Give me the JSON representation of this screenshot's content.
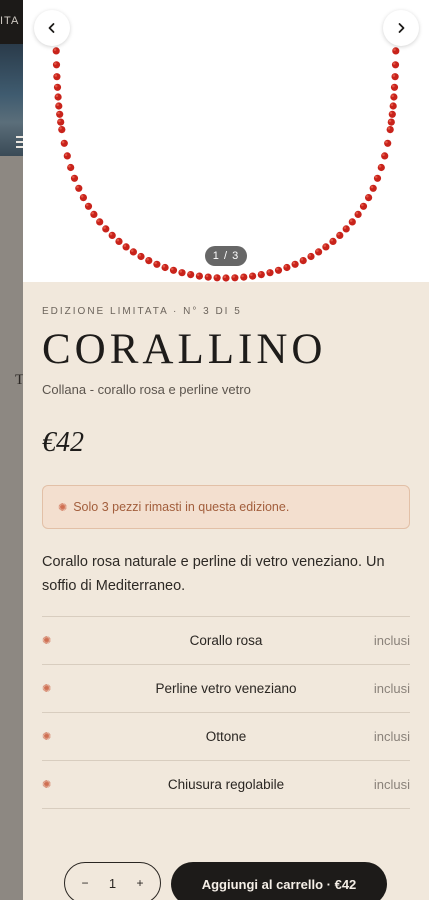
{
  "background": {
    "topbar_text": "ITA",
    "side_letter": "T"
  },
  "gallery": {
    "counter": "1 / 3",
    "prev_icon": "chevron-left-icon",
    "next_icon": "chevron-right-icon"
  },
  "product": {
    "eyebrow": "EDIZIONE LIMITATA · N° 3 DI 5",
    "title": "CORALLINO",
    "subtitle": "Collana - corallo rosa e perline vetro",
    "price": "€42",
    "notice": "Solo 3 pezzi rimasti in questa edizione.",
    "description": "Corallo rosa naturale e perline di vetro veneziano. Un soffio di Mediterraneo."
  },
  "materials": [
    {
      "name": "Corallo rosa",
      "status": "inclusi"
    },
    {
      "name": "Perline vetro veneziano",
      "status": "inclusi"
    },
    {
      "name": "Ottone",
      "status": "inclusi"
    },
    {
      "name": "Chiusura regolabile",
      "status": "inclusi"
    }
  ],
  "cart": {
    "decrement": "−",
    "quantity": "1",
    "increment": "+",
    "add_label": "Aggiungi al carrello · €42"
  },
  "colors": {
    "accent": "#cf6f52",
    "drawer_bg": "#f1e8dc",
    "button_dark": "#1d1b19",
    "bead_red": "#c8231b"
  }
}
